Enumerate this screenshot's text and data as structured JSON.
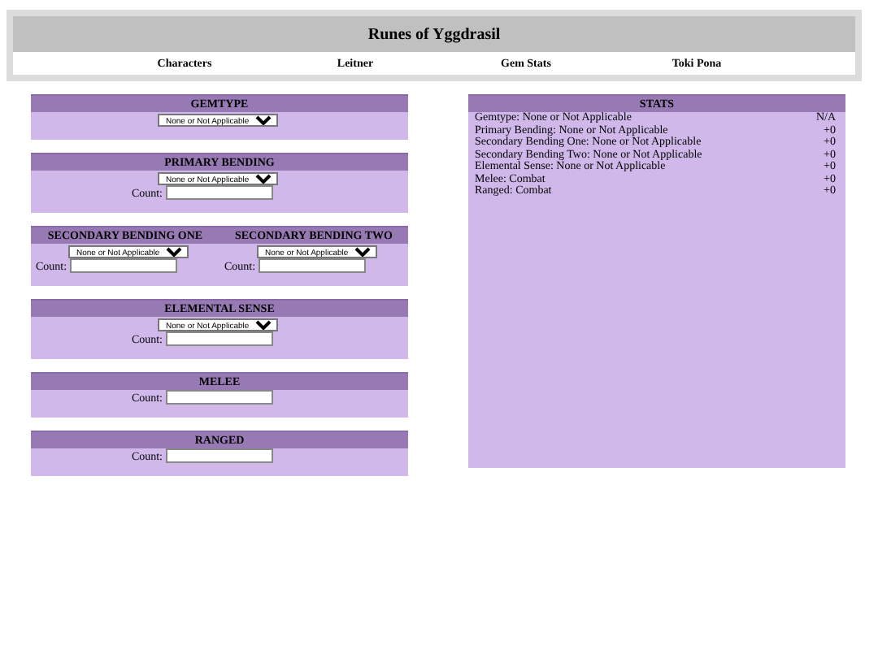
{
  "header": {
    "title": "Runes of Yggdrasil",
    "nav": [
      "Characters",
      "Leitner",
      "Gem Stats",
      "Toki Pona"
    ]
  },
  "panels": [
    {
      "columns": [
        {
          "title": "GEMTYPE",
          "select": "None or Not Applicable"
        }
      ]
    },
    {
      "columns": [
        {
          "title": "PRIMARY BENDING",
          "select": "None or Not Applicable",
          "count_label": "Count:"
        }
      ]
    },
    {
      "columns": [
        {
          "title": "SECONDARY BENDING ONE",
          "select": "None or Not Applicable",
          "count_label": "Count:"
        },
        {
          "title": "SECONDARY BENDING TWO",
          "select": "None or Not Applicable",
          "count_label": "Count:"
        }
      ]
    },
    {
      "columns": [
        {
          "title": "ELEMENTAL SENSE",
          "select": "None or Not Applicable",
          "count_label": "Count:"
        }
      ]
    },
    {
      "columns": [
        {
          "title": "MELEE",
          "count_label": "Count:"
        }
      ]
    },
    {
      "columns": [
        {
          "title": "RANGED",
          "count_label": "Count:"
        }
      ]
    }
  ],
  "stats": {
    "title": "STATS",
    "rows": [
      {
        "label": "Gemtype: None or Not Applicable",
        "value": "N/A"
      },
      {
        "label": "Primary Bending: None or Not Applicable",
        "value": "+0"
      },
      {
        "label": "Secondary Bending One: None or Not Applicable",
        "value": "+0"
      },
      {
        "label": "Secondary Bending Two: None or Not Applicable",
        "value": "+0"
      },
      {
        "label": "Elemental Sense: None or Not Applicable",
        "value": "+0"
      },
      {
        "label": "Melee: Combat",
        "value": "+0"
      },
      {
        "label": "Ranged: Combat",
        "value": "+0"
      }
    ]
  }
}
